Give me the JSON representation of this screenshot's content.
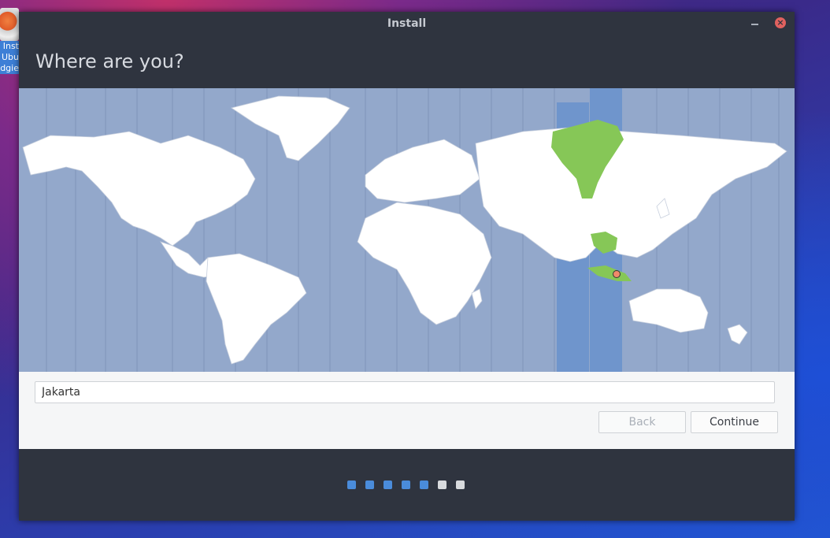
{
  "desktop": {
    "icon_label": "Inst\nUbu\ndgie"
  },
  "window": {
    "title": "Install"
  },
  "page": {
    "heading": "Where are you?"
  },
  "location": {
    "value": "Jakarta"
  },
  "buttons": {
    "back": "Back",
    "continue": "Continue"
  },
  "progress": {
    "total_steps": 7,
    "completed_steps": 5
  },
  "colors": {
    "map_ocean": "#93a8cb",
    "map_land": "#ffffff",
    "timezone_band": "#6f95cc",
    "timezone_highlight": "#86c757",
    "step_done": "#4a8cdb",
    "step_todo": "#d8dadd",
    "close": "#e0615f"
  }
}
